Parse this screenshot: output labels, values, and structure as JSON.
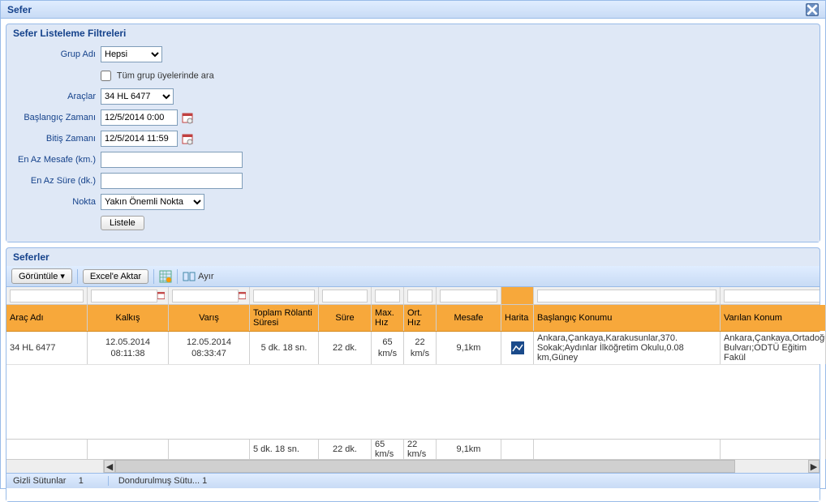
{
  "window": {
    "title": "Sefer"
  },
  "filters_panel": {
    "title": "Sefer Listeleme Filtreleri"
  },
  "filters": {
    "grup_adi_label": "Grup Adı",
    "grup_adi_value": "Hepsi",
    "tum_grup_label": "Tüm grup üyelerinde ara",
    "araclar_label": "Araçlar",
    "araclar_value": "34 HL 6477",
    "baslangic_label": "Başlangıç Zamanı",
    "baslangic_value": "12/5/2014 0:00",
    "bitis_label": "Bitiş Zamanı",
    "bitis_value": "12/5/2014 11:59",
    "min_mesafe_label": "En Az Mesafe (km.)",
    "min_sure_label": "En Az Süre (dk.)",
    "nokta_label": "Nokta",
    "nokta_value": "Yakın Önemli Nokta",
    "listele_btn": "Listele"
  },
  "grid_panel": {
    "title": "Seferler"
  },
  "toolbar": {
    "goruntule": "Görüntüle",
    "excel": "Excel'e Aktar",
    "ayir": "Ayır"
  },
  "columns": {
    "arac_adi": "Araç Adı",
    "kalkis": "Kalkış",
    "varis": "Varış",
    "rolanti": "Toplam Rölanti Süresi",
    "sure": "Süre",
    "maxhiz": "Max. Hız",
    "orthiz": "Ort. Hız",
    "mesafe": "Mesafe",
    "harita": "Harita",
    "baslangic": "Başlangıç Konumu",
    "varilan": "Varılan Konum"
  },
  "rows": [
    {
      "arac_adi": "34 HL 6477",
      "kalkis_date": "12.05.2014",
      "kalkis_time": "08:11:38",
      "varis_date": "12.05.2014",
      "varis_time": "08:33:47",
      "rolanti": "5 dk. 18 sn.",
      "sure": "22 dk.",
      "maxhiz": "65 km/s",
      "orthiz": "22 km/s",
      "mesafe": "9,1km",
      "baslangic": "Ankara,Çankaya,Karakusunlar,370. Sokak;Aydınlar İlköğretim Okulu,0.08 km,Güney",
      "varilan": "Ankara,Çankaya,Ortadoğu Bulvarı;ODTÜ Eğitim Fakül"
    }
  ],
  "summary": {
    "rolanti": "5 dk. 18 sn.",
    "sure": "22 dk.",
    "maxhiz": "65 km/s",
    "orthiz": "22 km/s",
    "mesafe": "9,1km"
  },
  "status": {
    "gizli_label": "Gizli Sütunlar",
    "gizli_count": "1",
    "dondurulmus": "Dondurulmuş Sütu... 1"
  }
}
